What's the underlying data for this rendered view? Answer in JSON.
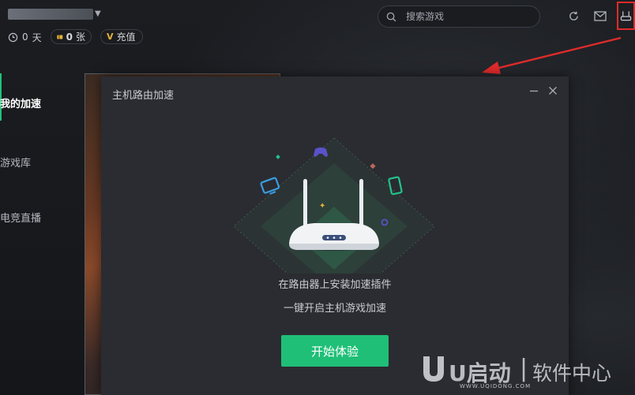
{
  "topbar": {
    "days_value": "0",
    "days_unit": "天",
    "tickets_value": "0",
    "tickets_unit": "张",
    "recharge_label": "充值",
    "search_placeholder": "搜索游戏"
  },
  "sidebar": {
    "items": [
      {
        "label": "我的加速"
      },
      {
        "label": "游戏库"
      },
      {
        "label": "电竞直播"
      }
    ]
  },
  "dialog": {
    "title": "主机路由加速",
    "line1": "在路由器上安装加速插件",
    "line2": "一键开启主机游戏加速",
    "button_label": "开始体验"
  },
  "watermark": {
    "brand": "U启动",
    "divider": "|",
    "slogan": "软件中心",
    "url": "WWW.UQIDONG.COM"
  },
  "colors": {
    "accent": "#1fbf78",
    "highlight": "#e02b2b",
    "dialog_bg": "#2a2c31"
  }
}
